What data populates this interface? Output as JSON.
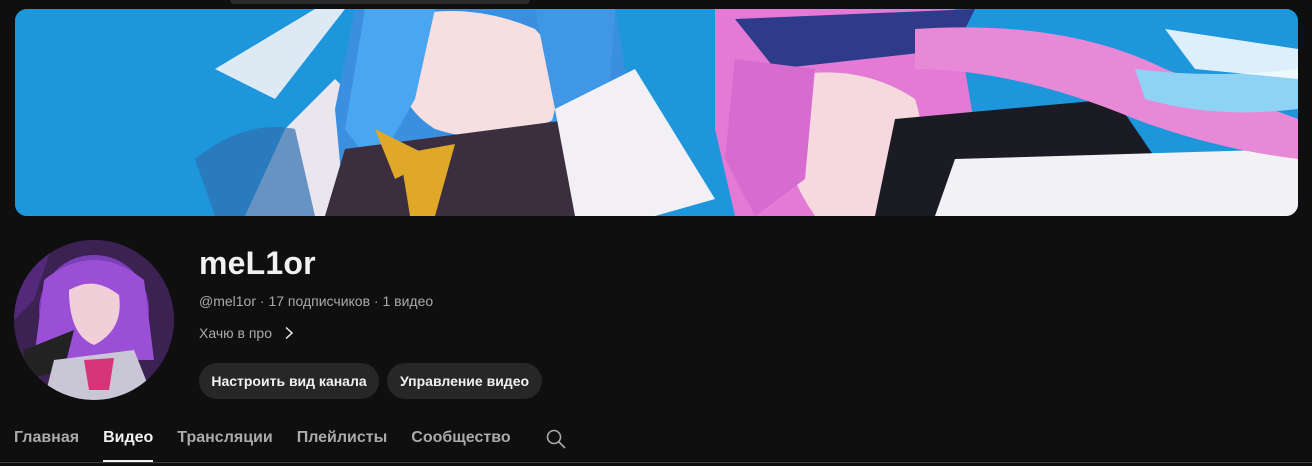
{
  "channel": {
    "name": "meL1or",
    "handle": "@mel1or",
    "subscribers": "17 подписчиков",
    "videos": "1 видео",
    "separator": " · ",
    "description": "Хачю в про"
  },
  "buttons": {
    "customize": "Настроить вид канала",
    "manage": "Управление видео"
  },
  "tabs": [
    {
      "label": "Главная",
      "active": false
    },
    {
      "label": "Видео",
      "active": true
    },
    {
      "label": "Трансляции",
      "active": false
    },
    {
      "label": "Плейлисты",
      "active": false
    },
    {
      "label": "Сообщество",
      "active": false
    }
  ],
  "icons": {
    "search": "search-icon",
    "chevron": "chevron-right-icon"
  },
  "colors": {
    "background": "#0f0f0f",
    "button_bg": "#272727",
    "text_primary": "#f1f1f1",
    "text_secondary": "#aaaaaa"
  }
}
